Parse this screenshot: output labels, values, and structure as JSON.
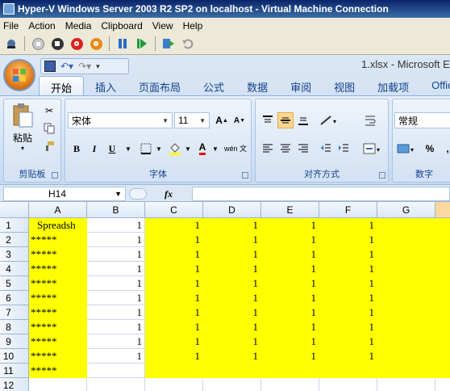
{
  "window": {
    "title": "Hyper-V Windows Server 2003 R2 SP2 on localhost - Virtual Machine Connection"
  },
  "host_menu": [
    "File",
    "Action",
    "Media",
    "Clipboard",
    "View",
    "Help"
  ],
  "host_toolbar_icons": [
    "ctrl-alt-del-icon",
    "turn-off-icon",
    "shut-down-icon",
    "power-icon",
    "pause-icon",
    "resume-icon",
    "snapshot-icon",
    "revert-icon"
  ],
  "excel": {
    "file_title": "1.xlsx - Microsoft E",
    "tabs": [
      "开始",
      "插入",
      "页面布局",
      "公式",
      "数据",
      "审阅",
      "视图",
      "加载项",
      "Office"
    ],
    "active_tab": "开始",
    "clipboard": {
      "paste_label": "粘贴",
      "group_label": "剪贴板"
    },
    "font": {
      "name": "宋体",
      "size": "11",
      "bold": "B",
      "italic": "I",
      "underline": "U",
      "wen": "wén 文",
      "group_label": "字体"
    },
    "alignment": {
      "group_label": "对齐方式"
    },
    "number": {
      "format": "常规",
      "percent": "%",
      "group_label": "数字"
    },
    "name_box": "H14",
    "fx": "fx",
    "formula": ""
  },
  "colors": {
    "highlight": "#ffff00",
    "selected_header": "#f9d99f",
    "ribbon": "#dbe7f5"
  },
  "sheet": {
    "columns": [
      "A",
      "B",
      "C",
      "D",
      "E",
      "F",
      "G"
    ],
    "rows": [
      "1",
      "2",
      "3",
      "4",
      "5",
      "6",
      "7",
      "8",
      "9",
      "10",
      "11",
      "12"
    ],
    "cells": [
      [
        "Spreadsh",
        "1",
        "1",
        "1",
        "1",
        "1",
        ""
      ],
      [
        "*****",
        "1",
        "1",
        "1",
        "1",
        "1",
        ""
      ],
      [
        "*****",
        "1",
        "1",
        "1",
        "1",
        "1",
        ""
      ],
      [
        "*****",
        "1",
        "1",
        "1",
        "1",
        "1",
        ""
      ],
      [
        "*****",
        "1",
        "1",
        "1",
        "1",
        "1",
        ""
      ],
      [
        "*****",
        "1",
        "1",
        "1",
        "1",
        "1",
        ""
      ],
      [
        "*****",
        "1",
        "1",
        "1",
        "1",
        "1",
        ""
      ],
      [
        "*****",
        "1",
        "1",
        "1",
        "1",
        "1",
        ""
      ],
      [
        "*****",
        "1",
        "1",
        "1",
        "1",
        "1",
        ""
      ],
      [
        "*****",
        "1",
        "1",
        "1",
        "1",
        "1",
        ""
      ],
      [
        "*****",
        "",
        "",
        "",
        "",
        "",
        ""
      ],
      [
        "",
        "",
        "",
        "",
        "",
        "",
        ""
      ]
    ]
  }
}
